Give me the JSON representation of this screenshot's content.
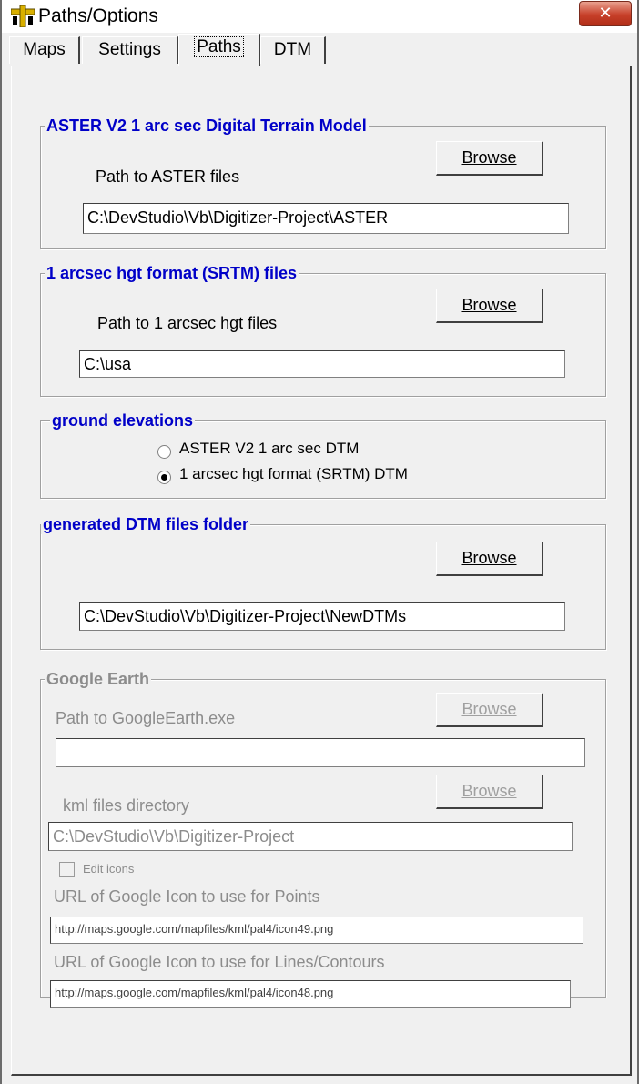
{
  "window": {
    "title": "Paths/Options",
    "close_label": "✕"
  },
  "tabs": [
    {
      "label": "Maps"
    },
    {
      "label": "Settings"
    },
    {
      "label": "Paths"
    },
    {
      "label": "DTM"
    }
  ],
  "aster": {
    "legend": "ASTER V2 1 arc sec Digital Terrain Model",
    "path_label": "Path to ASTER files",
    "browse_label": "Browse",
    "path_value": "C:\\DevStudio\\Vb\\Digitizer-Project\\ASTER"
  },
  "srtm": {
    "legend": "1 arcsec hgt format (SRTM) files",
    "path_label": "Path to  1 arcsec hgt files",
    "browse_label": "Browse",
    "path_value": "C:\\usa"
  },
  "ground": {
    "legend": "ground elevations",
    "options": [
      {
        "label": "ASTER V2 1 arc sec DTM",
        "selected": false
      },
      {
        "label": "1 arcsec hgt format (SRTM) DTM",
        "selected": true
      }
    ]
  },
  "generated": {
    "legend": "generated DTM files folder",
    "browse_label": "Browse",
    "path_value": "C:\\DevStudio\\Vb\\Digitizer-Project\\NewDTMs"
  },
  "google_earth": {
    "legend": "Google Earth",
    "exe_label": "Path to GoogleEarth.exe",
    "exe_browse_label": "Browse",
    "exe_value": "",
    "kml_label": "kml files directory",
    "kml_browse_label": "Browse",
    "kml_value": "C:\\DevStudio\\Vb\\Digitizer-Project",
    "edit_icons_label": "Edit icons",
    "points_icon_label": "URL of Google Icon to use for Points",
    "points_icon_value": "http://maps.google.com/mapfiles/kml/pal4/icon49.png",
    "lines_icon_label": "URL of Google Icon to use for Lines/Contours",
    "lines_icon_value": "http://maps.google.com/mapfiles/kml/pal4/icon48.png"
  }
}
